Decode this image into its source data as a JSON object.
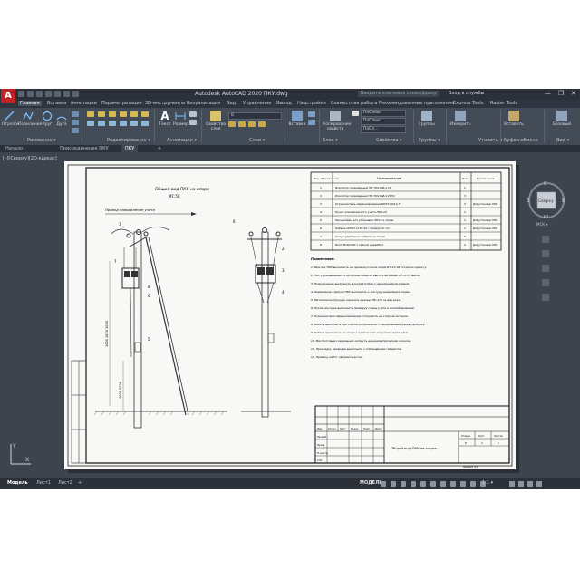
{
  "app": {
    "logo": "A",
    "window_title": "Autodesk AutoCAD 2020    ПКУ.dwg",
    "search_placeholder": "Введите ключевое слово/фразу",
    "signin": "Вход в службы",
    "controls": [
      "—",
      "❐",
      "✕"
    ]
  },
  "ribbon_tabs": [
    "Главная",
    "Вставка",
    "Аннотации",
    "Параметризация",
    "3D-инструменты",
    "Визуализация",
    "Вид",
    "Управление",
    "Вывод",
    "Надстройки",
    "Совместная работа",
    "Рекомендованные приложения",
    "Express Tools",
    "Raster Tools"
  ],
  "ribbon": {
    "draw_tools": [
      "Отрезок",
      "Полилиния",
      "Круг",
      "Дуга"
    ],
    "text_tool": "Текст",
    "dim_tool": "Размер",
    "table_tool": "Свойства слоя",
    "insert_tool": "Вставка",
    "match_tool": "Копирование свойств",
    "groups_tool": "Группы",
    "measure_tool": "Измерить",
    "paste_tool": "Вставить",
    "base_tool": "Базовый",
    "group_labels": {
      "draw": "Рисование ▾",
      "modify": "Редактирование ▾",
      "annotation": "Аннотации ▾",
      "layers": "Слои ▾",
      "block": "Блок ▾",
      "properties": "Свойства ▾",
      "groups": "Группы ▾",
      "utilities": "Утилиты ▾",
      "clipboard": "Буфер обмена",
      "view": "Вид ▾"
    },
    "layer_value": "0",
    "props": [
      "ПоСлою",
      "ПоСлою",
      "ПоСл..."
    ]
  },
  "doc_tabs": [
    "Начало",
    "Присоединение ПКУ",
    "ПКУ"
  ],
  "viewport_label": "[–][Сверху][2D-каркас]",
  "viewcube": {
    "top": "С",
    "face": "Сверху",
    "right": "В",
    "bottom": "Ю",
    "left": "З",
    "wcs": "МСК ▾"
  },
  "drawing": {
    "title_left": "Общий вид ПКУ на опоре",
    "subtitle_left": "М1:50",
    "arrow_label": "Провод направление учета",
    "dims": [
      "1000 1650 1000",
      "3000 5200"
    ],
    "table_header": [
      "Поз. обозначение",
      "Наименование",
      "Кол.",
      "Примечание"
    ],
    "table_rows": [
      [
        "1",
        "Изолятор полимерный ЛК 70/10-И-4 СС",
        "1",
        ""
      ],
      [
        "2",
        "Изолятор полимерный ЛК 70/10-И-4 УХЛ1",
        "3",
        ""
      ],
      [
        "3",
        "Ограничитель перенапряжений ОПН-10/12,7",
        "3",
        "Для установки ПКУ"
      ],
      [
        "4",
        "Пункт коммерческого учёта ПКУ-10",
        "1",
        ""
      ],
      [
        "5",
        "Кронштейн для установки ПКУ на опоре",
        "1",
        "Для установки ПКУ"
      ],
      [
        "6",
        "Кабель СИП-3 1х70-20 / провод АС-70",
        "1",
        "Для установки ПКУ"
      ],
      [
        "7",
        "Хомут крепления кабеля на опоре",
        "5",
        ""
      ],
      [
        "8",
        "Болт М16х300 с гайкой и шайбой",
        "2",
        "Для установки ПКУ"
      ]
    ],
    "notes_title": "Примечание:",
    "notes": [
      "1. Монтаж ПКУ выполнить на промежуточной опоре ВЛ-10 кВ согласно проекту.",
      "2. ПКУ устанавливается на кронштейне на высоте не менее 4,5 м от земли.",
      "3. Подключение выполнить в соответствии с однолинейной схемой.",
      "4. Заземление корпуса ПКУ выполнить к контуру заземления опоры.",
      "5. Металлоконструкции окрасить эмалью ПФ-115 за два раза.",
      "6. После монтажа выполнить проверку схемы учёта и опломбирование.",
      "7. Ограничители перенапряжений установить на стороне питания.",
      "8. Работы выполнять при снятом напряжении с оформлением наряда-допуска.",
      "9. Кабель проложить по опоре с креплением хомутами через 0,5 м.",
      "10. Все болтовые соединения затянуть динамометрическим ключом.",
      "11. Прокладку проводов выполнить с соблюдением габаритов.",
      "12. Приёмку работ оформить актом."
    ],
    "stamp_title": "Общий вид ПКУ на опоре",
    "stamp_roles": [
      "Разраб.",
      "Пров.",
      "Н.контр.",
      "Утв."
    ],
    "stamp_cols": [
      "Изм.",
      "Кол.уч",
      "Лист",
      "№ док.",
      "Подп.",
      "Дата"
    ],
    "stamp_sheet_head": [
      "Стадия",
      "Лист",
      "Листов"
    ],
    "stamp_sheet_vals": [
      "Р",
      "1",
      "1"
    ],
    "format_label": "Формат А3"
  },
  "status": {
    "layout_tabs": [
      "Модель",
      "Лист1",
      "Лист2"
    ],
    "model_label": "МОДЕЛЬ",
    "scale": "1:1 ▾"
  },
  "colors": {
    "accent": "#c42127",
    "ribbon": "#434b57",
    "workspace": "#3d444e",
    "sheet": "#f8f8f6"
  }
}
